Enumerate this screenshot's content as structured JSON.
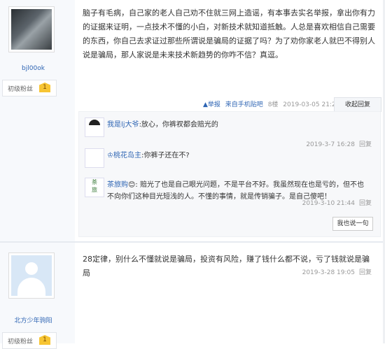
{
  "post1": {
    "username": "bjl00ok",
    "badge": "初级粉丝",
    "level": "1",
    "content": "脑子有毛病，自己家的老人自己劝不住就三网上造谣，有本事去实名举报，拿出你有力的证据来证明，一点技术不懂的小白，对新技术就知道抵触。人总是喜欢相信自己需要的东西，你自己去求证过那些所谓说是骗局的证据了吗？为了劝你家老人就巴不得别人说是骗局，那人家说是未来技术新趋势的你咋不信？真逗。",
    "meta": {
      "report": "▲举报",
      "source": "来自手机贴吧",
      "floor": "8楼",
      "time": "2019-03-05 21:22",
      "collapse": "收起回复"
    },
    "replies": [
      {
        "user": "我是lj大爷",
        "text": ":放心，你裤衩都会赔光的",
        "time": "2019-3-7 16:28",
        "reply": "回复"
      },
      {
        "user": "♔桃花岛主",
        "text": ":你裤子还在不?",
        "time": "2019-3-10 21:44",
        "reply": "回复"
      },
      {
        "user": "茶旅购",
        "text": "😊: 赔光了也是自己眼光问题，不是平台不好。我虽然现在也是亏的，但不也不向你们这种目光短浅的人。不懂的事情，就是传销骗子。是自己傻吧！",
        "time": "2019-3-28 19:05",
        "reply": "回复"
      }
    ],
    "say_button": "我也说一句"
  },
  "post2": {
    "username": "北方少年驹阳",
    "badge": "初级粉丝",
    "level": "1",
    "content": "28定律，别什么不懂就说是骗局，投资有风险，赚了钱什么都不说，亏了钱就说是骗局"
  },
  "icons": {
    "avatar1": "anime-character-avatar",
    "avatar_default": "default-user-avatar",
    "level_badge": "shield-badge"
  },
  "colors": {
    "link_blue": "#2d64b3",
    "left_panel": "#f7f9fc",
    "badge_gold": "#f7c533"
  }
}
